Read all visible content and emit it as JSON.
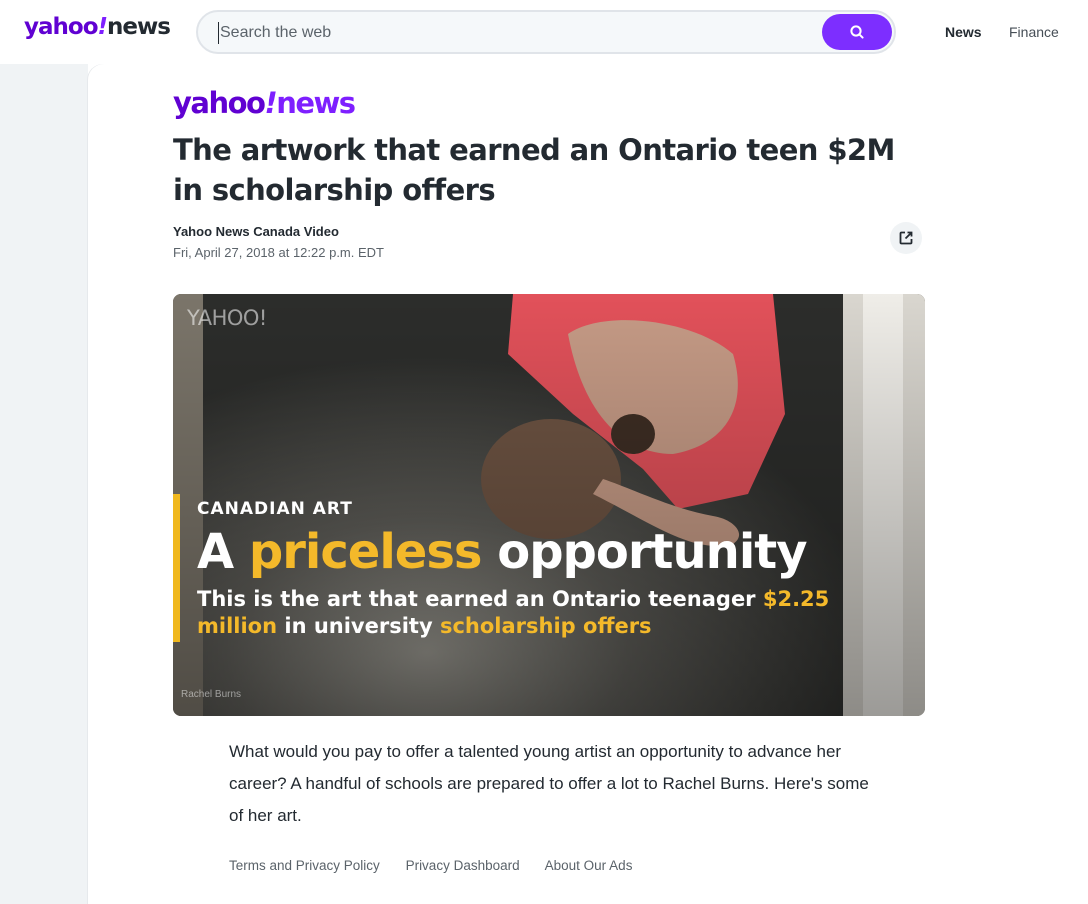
{
  "header": {
    "logo_main": "yahoo",
    "logo_excl": "!",
    "logo_news": "news",
    "search_placeholder": "Search the web",
    "nav": [
      "News",
      "Finance"
    ]
  },
  "article": {
    "logo_main": "yahoo",
    "logo_excl": "!",
    "logo_news": "news",
    "headline": "The artwork that earned an Ontario teen $2M in scholarship offers",
    "byline": "Yahoo News Canada Video",
    "date": "Fri, April 27, 2018 at 12:22 p.m. EDT",
    "body": "What would you pay to offer a talented young artist an opportunity to advance her career? A handful of schools are prepared to offer a lot to Rachel Burns. Here's some of her art."
  },
  "video": {
    "watermark": "YAHOO!",
    "kicker": "CANADIAN ART",
    "title_a": "A ",
    "title_hl": "priceless",
    "title_b": " opportunity",
    "sub_a": "This is the art that earned an Ontario teenager ",
    "sub_hl1": "$2.25 million",
    "sub_b": " in university ",
    "sub_hl2": "scholarship offers",
    "credit": "Rachel Burns"
  },
  "footer": {
    "links": [
      "Terms and Privacy Policy",
      "Privacy Dashboard",
      "About Our Ads"
    ]
  },
  "colors": {
    "brand": "#6001d2",
    "accent": "#7d2eff",
    "highlight": "#f4b92a"
  }
}
